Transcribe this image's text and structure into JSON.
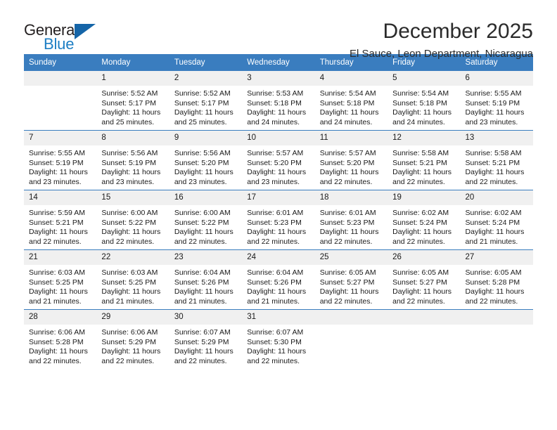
{
  "brand": {
    "name_part1": "General",
    "name_part2": "Blue",
    "triangle_color": "#1565a8",
    "blue_color": "#1d7ec4",
    "dark_color": "#231f20"
  },
  "header": {
    "title": "December 2025",
    "subtitle": "El Sauce, Leon Department, Nicaragua",
    "header_bg": "#3a7dbf",
    "daynum_bg": "#f0f0f0"
  },
  "weekday_headers": [
    "Sunday",
    "Monday",
    "Tuesday",
    "Wednesday",
    "Thursday",
    "Friday",
    "Saturday"
  ],
  "labels": {
    "sunrise_prefix": "Sunrise:",
    "sunset_prefix": "Sunset:",
    "daylight_prefix": "Daylight:"
  },
  "weeks": [
    [
      {
        "day": ""
      },
      {
        "day": "1",
        "sunrise": "Sunrise: 5:52 AM",
        "sunset": "Sunset: 5:17 PM",
        "daylight_l1": "Daylight: 11 hours",
        "daylight_l2": "and 25 minutes."
      },
      {
        "day": "2",
        "sunrise": "Sunrise: 5:52 AM",
        "sunset": "Sunset: 5:17 PM",
        "daylight_l1": "Daylight: 11 hours",
        "daylight_l2": "and 25 minutes."
      },
      {
        "day": "3",
        "sunrise": "Sunrise: 5:53 AM",
        "sunset": "Sunset: 5:18 PM",
        "daylight_l1": "Daylight: 11 hours",
        "daylight_l2": "and 24 minutes."
      },
      {
        "day": "4",
        "sunrise": "Sunrise: 5:54 AM",
        "sunset": "Sunset: 5:18 PM",
        "daylight_l1": "Daylight: 11 hours",
        "daylight_l2": "and 24 minutes."
      },
      {
        "day": "5",
        "sunrise": "Sunrise: 5:54 AM",
        "sunset": "Sunset: 5:18 PM",
        "daylight_l1": "Daylight: 11 hours",
        "daylight_l2": "and 24 minutes."
      },
      {
        "day": "6",
        "sunrise": "Sunrise: 5:55 AM",
        "sunset": "Sunset: 5:19 PM",
        "daylight_l1": "Daylight: 11 hours",
        "daylight_l2": "and 23 minutes."
      }
    ],
    [
      {
        "day": "7",
        "sunrise": "Sunrise: 5:55 AM",
        "sunset": "Sunset: 5:19 PM",
        "daylight_l1": "Daylight: 11 hours",
        "daylight_l2": "and 23 minutes."
      },
      {
        "day": "8",
        "sunrise": "Sunrise: 5:56 AM",
        "sunset": "Sunset: 5:19 PM",
        "daylight_l1": "Daylight: 11 hours",
        "daylight_l2": "and 23 minutes."
      },
      {
        "day": "9",
        "sunrise": "Sunrise: 5:56 AM",
        "sunset": "Sunset: 5:20 PM",
        "daylight_l1": "Daylight: 11 hours",
        "daylight_l2": "and 23 minutes."
      },
      {
        "day": "10",
        "sunrise": "Sunrise: 5:57 AM",
        "sunset": "Sunset: 5:20 PM",
        "daylight_l1": "Daylight: 11 hours",
        "daylight_l2": "and 23 minutes."
      },
      {
        "day": "11",
        "sunrise": "Sunrise: 5:57 AM",
        "sunset": "Sunset: 5:20 PM",
        "daylight_l1": "Daylight: 11 hours",
        "daylight_l2": "and 22 minutes."
      },
      {
        "day": "12",
        "sunrise": "Sunrise: 5:58 AM",
        "sunset": "Sunset: 5:21 PM",
        "daylight_l1": "Daylight: 11 hours",
        "daylight_l2": "and 22 minutes."
      },
      {
        "day": "13",
        "sunrise": "Sunrise: 5:58 AM",
        "sunset": "Sunset: 5:21 PM",
        "daylight_l1": "Daylight: 11 hours",
        "daylight_l2": "and 22 minutes."
      }
    ],
    [
      {
        "day": "14",
        "sunrise": "Sunrise: 5:59 AM",
        "sunset": "Sunset: 5:21 PM",
        "daylight_l1": "Daylight: 11 hours",
        "daylight_l2": "and 22 minutes."
      },
      {
        "day": "15",
        "sunrise": "Sunrise: 6:00 AM",
        "sunset": "Sunset: 5:22 PM",
        "daylight_l1": "Daylight: 11 hours",
        "daylight_l2": "and 22 minutes."
      },
      {
        "day": "16",
        "sunrise": "Sunrise: 6:00 AM",
        "sunset": "Sunset: 5:22 PM",
        "daylight_l1": "Daylight: 11 hours",
        "daylight_l2": "and 22 minutes."
      },
      {
        "day": "17",
        "sunrise": "Sunrise: 6:01 AM",
        "sunset": "Sunset: 5:23 PM",
        "daylight_l1": "Daylight: 11 hours",
        "daylight_l2": "and 22 minutes."
      },
      {
        "day": "18",
        "sunrise": "Sunrise: 6:01 AM",
        "sunset": "Sunset: 5:23 PM",
        "daylight_l1": "Daylight: 11 hours",
        "daylight_l2": "and 22 minutes."
      },
      {
        "day": "19",
        "sunrise": "Sunrise: 6:02 AM",
        "sunset": "Sunset: 5:24 PM",
        "daylight_l1": "Daylight: 11 hours",
        "daylight_l2": "and 22 minutes."
      },
      {
        "day": "20",
        "sunrise": "Sunrise: 6:02 AM",
        "sunset": "Sunset: 5:24 PM",
        "daylight_l1": "Daylight: 11 hours",
        "daylight_l2": "and 21 minutes."
      }
    ],
    [
      {
        "day": "21",
        "sunrise": "Sunrise: 6:03 AM",
        "sunset": "Sunset: 5:25 PM",
        "daylight_l1": "Daylight: 11 hours",
        "daylight_l2": "and 21 minutes."
      },
      {
        "day": "22",
        "sunrise": "Sunrise: 6:03 AM",
        "sunset": "Sunset: 5:25 PM",
        "daylight_l1": "Daylight: 11 hours",
        "daylight_l2": "and 21 minutes."
      },
      {
        "day": "23",
        "sunrise": "Sunrise: 6:04 AM",
        "sunset": "Sunset: 5:26 PM",
        "daylight_l1": "Daylight: 11 hours",
        "daylight_l2": "and 21 minutes."
      },
      {
        "day": "24",
        "sunrise": "Sunrise: 6:04 AM",
        "sunset": "Sunset: 5:26 PM",
        "daylight_l1": "Daylight: 11 hours",
        "daylight_l2": "and 21 minutes."
      },
      {
        "day": "25",
        "sunrise": "Sunrise: 6:05 AM",
        "sunset": "Sunset: 5:27 PM",
        "daylight_l1": "Daylight: 11 hours",
        "daylight_l2": "and 22 minutes."
      },
      {
        "day": "26",
        "sunrise": "Sunrise: 6:05 AM",
        "sunset": "Sunset: 5:27 PM",
        "daylight_l1": "Daylight: 11 hours",
        "daylight_l2": "and 22 minutes."
      },
      {
        "day": "27",
        "sunrise": "Sunrise: 6:05 AM",
        "sunset": "Sunset: 5:28 PM",
        "daylight_l1": "Daylight: 11 hours",
        "daylight_l2": "and 22 minutes."
      }
    ],
    [
      {
        "day": "28",
        "sunrise": "Sunrise: 6:06 AM",
        "sunset": "Sunset: 5:28 PM",
        "daylight_l1": "Daylight: 11 hours",
        "daylight_l2": "and 22 minutes."
      },
      {
        "day": "29",
        "sunrise": "Sunrise: 6:06 AM",
        "sunset": "Sunset: 5:29 PM",
        "daylight_l1": "Daylight: 11 hours",
        "daylight_l2": "and 22 minutes."
      },
      {
        "day": "30",
        "sunrise": "Sunrise: 6:07 AM",
        "sunset": "Sunset: 5:29 PM",
        "daylight_l1": "Daylight: 11 hours",
        "daylight_l2": "and 22 minutes."
      },
      {
        "day": "31",
        "sunrise": "Sunrise: 6:07 AM",
        "sunset": "Sunset: 5:30 PM",
        "daylight_l1": "Daylight: 11 hours",
        "daylight_l2": "and 22 minutes."
      },
      {
        "day": ""
      },
      {
        "day": ""
      },
      {
        "day": ""
      }
    ]
  ]
}
